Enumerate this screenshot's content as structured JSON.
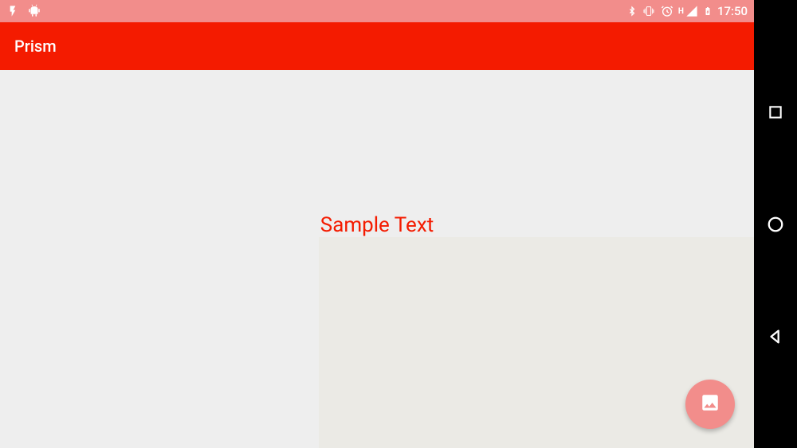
{
  "status_bar": {
    "time": "17:50",
    "network_label": "H",
    "icons": {
      "flash": "flash-icon",
      "bugdroid": "bugdroid-icon",
      "bluetooth": "bluetooth-icon",
      "vibrate": "vibrate-icon",
      "alarm": "alarm-icon",
      "signal": "signal-icon",
      "battery": "battery-charging-icon"
    }
  },
  "toolbar": {
    "title": "Prism"
  },
  "content": {
    "sample_text": "Sample Text"
  },
  "fab": {
    "icon": "image-icon"
  },
  "nav": {
    "recent": "recent-apps",
    "home": "home",
    "back": "back"
  }
}
